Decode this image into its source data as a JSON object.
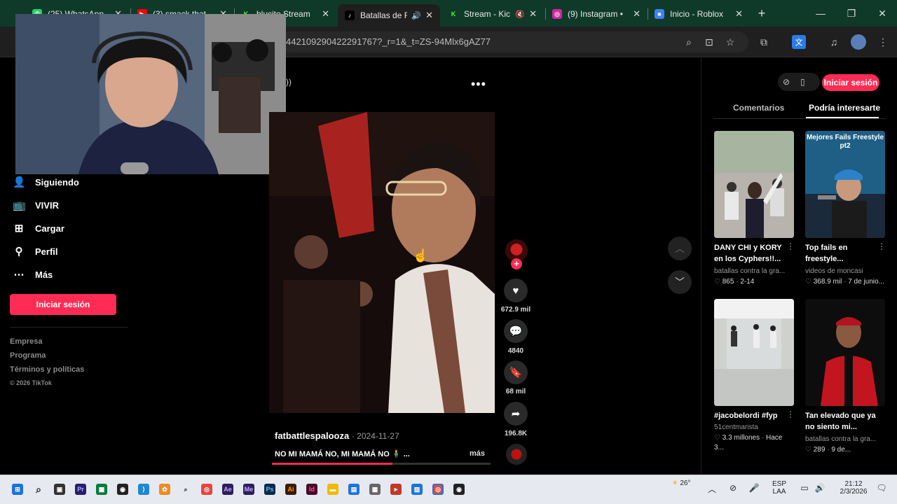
{
  "browser": {
    "tabs": [
      {
        "title": "(25) WhatsApp",
        "favicon": "whatsapp-icon",
        "color": "#25d366"
      },
      {
        "title": "(3) smack that",
        "favicon": "youtube-icon",
        "color": "#ff0000"
      },
      {
        "title": "blucito Stream",
        "favicon": "kick-icon",
        "color": "#53fc18"
      },
      {
        "title": "Batallas de F",
        "favicon": "tiktok-icon",
        "color": "#000000",
        "active": true
      },
      {
        "title": "Stream - Kic",
        "favicon": "kick-icon",
        "color": "#53fc18"
      },
      {
        "title": "(9) Instagram •",
        "favicon": "instagram-icon",
        "color": "#d6249f"
      },
      {
        "title": "Inicio - Roblox",
        "favicon": "roblox-icon",
        "color": "#3b82f6"
      }
    ],
    "url": "442109290422291767?_r=1&_t=ZS-94Mlx6gAZ77"
  },
  "sidebar": {
    "items": [
      {
        "label": "Siguiendo",
        "icon": "following-icon"
      },
      {
        "label": "VIVIR",
        "icon": "live-icon"
      },
      {
        "label": "Cargar",
        "icon": "upload-icon"
      },
      {
        "label": "Perfil",
        "icon": "profile-icon"
      },
      {
        "label": "Más",
        "icon": "more-icon"
      }
    ],
    "login_label": "Iniciar sesión",
    "footer": [
      "Empresa",
      "Programa",
      "Términos y políticas",
      "© 2026 TikTok"
    ]
  },
  "video": {
    "author": "fatbattlespalooza",
    "date": "· 2024-11-27",
    "caption": "NO MI MAMÁ NO, MI MAMÁ NO 🧍‍♂️ ...",
    "more_label": "más",
    "progress": 0.55,
    "likes": "672.9 mil",
    "comments": "4840",
    "saves": "68 mil",
    "shares": "196.8K"
  },
  "right_panel": {
    "login_label": "Iniciar sesión",
    "tabs": [
      "Comentarios",
      "Podría interesarte"
    ],
    "cards": [
      {
        "title": "DANY CHI y KORY en los Cyphers!!...",
        "author": "batallas contra la gra...",
        "likes": "865",
        "date": "2-14"
      },
      {
        "title": "Top fails en freestyle...",
        "author": "videos de moncasi",
        "likes": "368.9 mil",
        "date": "7 de junio...",
        "thumb_text": "Mejores Fails Freestyle pt2"
      },
      {
        "title": "#jacobelordi #fyp",
        "author": "51centmarista",
        "likes": "3.3 millones",
        "date": "Hace 3..."
      },
      {
        "title": "Tan elevado que ya no siento mi...",
        "author": "batallas contra la gra...",
        "likes": "289",
        "date": "9 de..."
      }
    ]
  },
  "taskbar": {
    "weather": "26°",
    "lang": "ESP",
    "region": "LAA",
    "time": "21:12",
    "date": "2/3/2026"
  },
  "colors": {
    "accent": "#fe2c55",
    "tab_strip": "#0f3a2a"
  }
}
